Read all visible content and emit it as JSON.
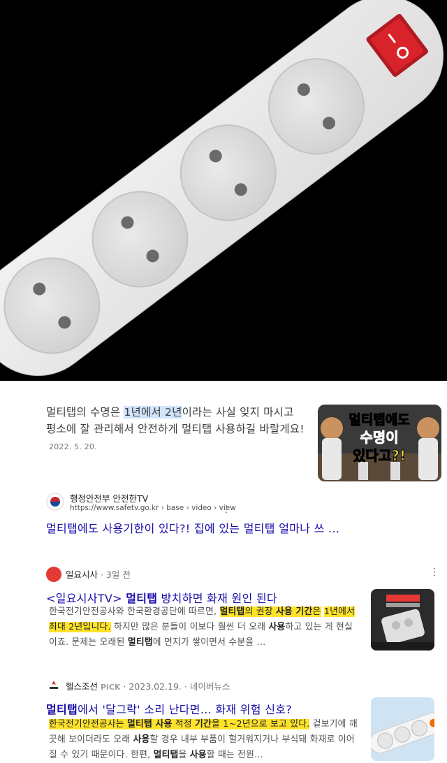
{
  "featured": {
    "text_before": "멀티탭의 수명은 ",
    "text_highlight": "1년에서 2년",
    "text_after": "이라는 사실 잊지 마시고 평소에 잘 관리해서 안전하게 멀티탭 사용하길 바랄게요!",
    "date": "2022. 5. 20.",
    "thumbnail_caption": "멀티탭에도 수명이 있다고?!"
  },
  "result1": {
    "source_name": "행정안전부 안전한TV",
    "url": "https://www.safetv.go.kr › base › video › view",
    "title": "멀티탭에도 사용기한이 있다?! 집에 있는 멀티탭 얼마나 쓰 ..."
  },
  "result2": {
    "source_name": "일요시사",
    "meta": " · 3일 전",
    "title_prefix": "<일요시사TV> ",
    "title_bold": "멀티탭",
    "title_suffix": " 방치하면 화재 원인 된다",
    "body_plain1": "한국전기안전공사와 한국환경공단에 따르면, ",
    "body_hl1_bold": "멀티탭",
    "body_hl1_a": "의 권장 ",
    "body_hl1_bold2": "사용 기간",
    "body_hl1_b": "은",
    "body_hl2": "1년에서 최대 2년입니다.",
    "body_plain2": " 하지만 많은 분들이 이보다 훨씬 더 오래 ",
    "body_bold3": "사용",
    "body_plain3": "하고 있는 게 현실이죠. 문제는 오래된 ",
    "body_bold4": "멀티탭",
    "body_plain4": "에 먼지가 쌓이면서 수분을 ..."
  },
  "result3": {
    "source_name": "헬스조선",
    "pick": "PiCK",
    "meta": " · 2023.02.19. · 네이버뉴스",
    "title_bold": "멀티탭",
    "title_rest": "에서 '달그락' 소리 난다면... 화재 위험 신호?",
    "body_hl_a": "한국전기안전공사는 ",
    "body_hl_bold1": "멀티탭 사용",
    "body_hl_b": " 적정 ",
    "body_hl_bold2": "기간",
    "body_hl_c": "을 1~2년으로 보고 있다.",
    "body_plain1": " 겉보기에 깨끗해 보이더라도 오래 ",
    "body_bold3": "사용",
    "body_plain2": "할 경우 내부 부품이 헐거워지거나 부식돼 화재로 이어질 수 있기 때문이다. 한편, ",
    "body_bold4": "멀티탭",
    "body_plain3": "을 ",
    "body_bold5": "사용",
    "body_plain4": "할 때는 전원..."
  },
  "colors": {
    "link": "#1a0dab",
    "highlight_yellow": "#ffe32b",
    "highlight_blue": "#d2e3fc",
    "switch_red": "#d8232a"
  },
  "icons": {
    "kebab": "⋮"
  }
}
